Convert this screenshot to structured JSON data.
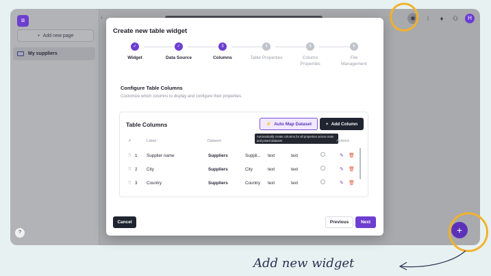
{
  "sidebar": {
    "add_page_label": "Add new page",
    "items": [
      {
        "label": "My suppliers"
      }
    ],
    "help_label": "?"
  },
  "modal": {
    "title": "Create new table widget",
    "steps": [
      {
        "number": "1",
        "label": "Widget",
        "state": "done"
      },
      {
        "number": "2",
        "label": "Data Source",
        "state": "done"
      },
      {
        "number": "3",
        "label": "Columns",
        "state": "current"
      },
      {
        "number": "4",
        "label": "Table Properties",
        "state": "todo"
      },
      {
        "number": "5",
        "label": "Column Properties",
        "state": "todo"
      },
      {
        "number": "6",
        "label": "File Management",
        "state": "todo"
      }
    ],
    "section_title": "Configure Table Columns",
    "section_desc": "Customize which columns to display and configure their properties.",
    "card_title": "Table Columns",
    "auto_map_label": "Auto Map Dataset",
    "add_column_label": "Add Column",
    "tooltip": "Automatically create columns for all properties across main and joined datasets",
    "headers": {
      "index": "#",
      "label": "Label",
      "dataset": "Dataset",
      "actions": "Actions"
    },
    "rows": [
      {
        "index": "1",
        "label": "Supplier name",
        "dataset": "Suppliers",
        "property": "Suppli...",
        "type": "text",
        "format": "text"
      },
      {
        "index": "2",
        "label": "City",
        "dataset": "Suppliers",
        "property": "City",
        "type": "text",
        "format": "text"
      },
      {
        "index": "3",
        "label": "Country",
        "dataset": "Suppliers",
        "property": "Country",
        "type": "text",
        "format": "text"
      }
    ],
    "cancel_label": "Cancel",
    "previous_label": "Previous",
    "next_label": "Next"
  },
  "fab_label": "+",
  "annotation": "Add new widget",
  "colors": {
    "accent": "#6d3fd0",
    "highlight": "#f2b22c",
    "dark": "#1f2430"
  }
}
